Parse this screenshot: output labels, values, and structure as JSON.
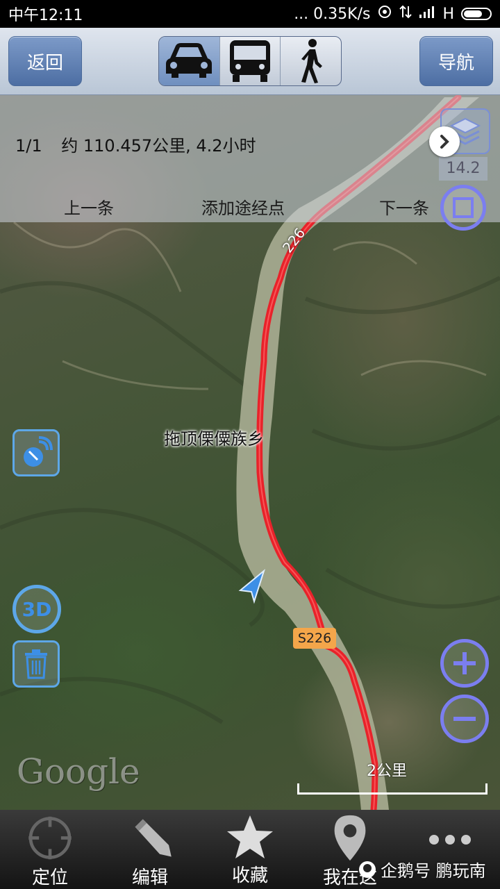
{
  "status_bar": {
    "time": "中午12:11",
    "network_speed": "... 0.35K/s",
    "signal_text": "H"
  },
  "header": {
    "back_label": "返回",
    "navigate_label": "导航",
    "modes": [
      {
        "icon": "car-icon",
        "active": true
      },
      {
        "icon": "bus-icon",
        "active": false
      },
      {
        "icon": "walk-icon",
        "active": false
      }
    ]
  },
  "route": {
    "index": "1/1",
    "summary": "约 110.457公里, 4.2小时",
    "prev_label": "上一条",
    "add_waypoint_label": "添加途经点",
    "next_label": "下一条"
  },
  "map": {
    "zoom_level": "14.2",
    "place_label": "拖顶傈僳族乡",
    "road_shield": "S226",
    "road_label_top": "226",
    "scale_label": "2公里",
    "logo": "Google",
    "route_color": "#e8222a",
    "river_color": "#a8ad92"
  },
  "bottom_tabs": [
    {
      "label": "定位",
      "icon": "crosshair-icon"
    },
    {
      "label": "编辑",
      "icon": "pencil-icon"
    },
    {
      "label": "收藏",
      "icon": "star-icon"
    },
    {
      "label": "我在这",
      "icon": "pin-icon"
    },
    {
      "label": "",
      "icon": "more-icon"
    }
  ],
  "watermark": "企鹅号 鹏玩南"
}
